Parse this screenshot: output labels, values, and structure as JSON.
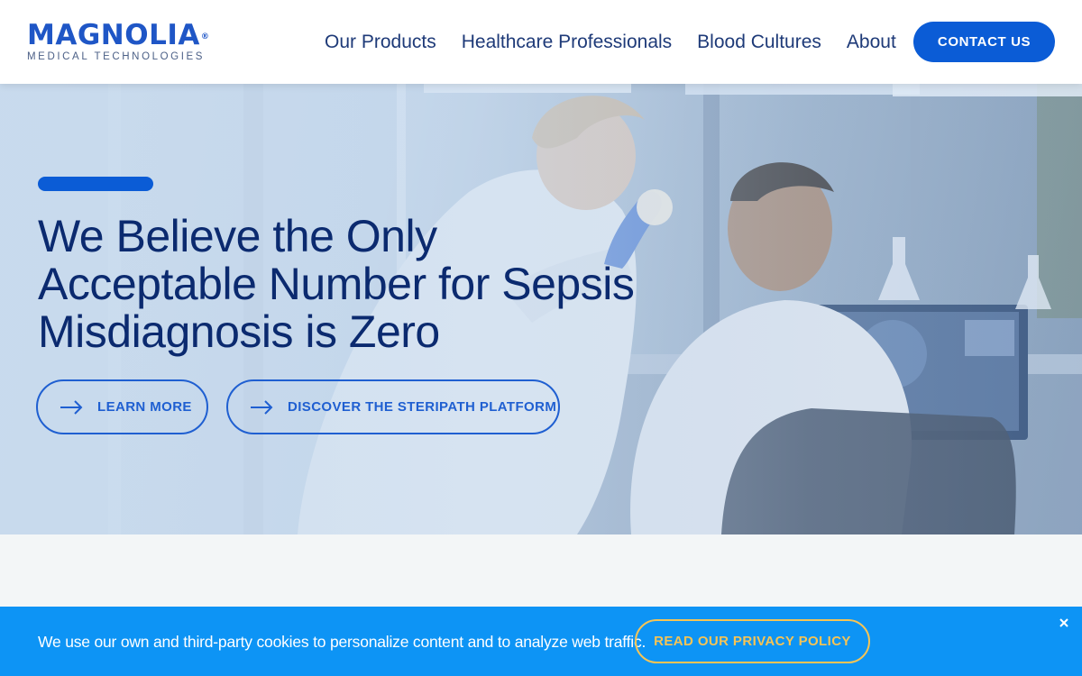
{
  "header": {
    "logo_text": "MAGNOLIA",
    "logo_trademark": "®",
    "logo_subtitle": "MEDICAL TECHNOLOGIES",
    "nav": [
      {
        "label": "Our Products"
      },
      {
        "label": "Healthcare Professionals"
      },
      {
        "label": "Blood Cultures"
      },
      {
        "label": "About"
      }
    ],
    "contact_label": "CONTACT US"
  },
  "hero": {
    "title_lines": [
      "We Believe the Only",
      "Acceptable Number for Sepsis",
      "Misdiagnosis is Zero"
    ],
    "learn_more_label": "LEARN MORE",
    "discover_label": "DISCOVER THE STERIPATH PLATFORM",
    "arrow_icon": "arrow-right-icon"
  },
  "cookie_banner": {
    "text": "We use our own and third-party cookies to personalize content and to analyze web traffic.",
    "policy_label": "READ OUR PRIVACY POLICY",
    "close_icon": "close-icon"
  },
  "colors": {
    "brand_blue": "#0b5cd6",
    "title_navy": "#0b2a6f",
    "cookie_bg": "#0d94f5",
    "cookie_accent": "#f6c455"
  }
}
